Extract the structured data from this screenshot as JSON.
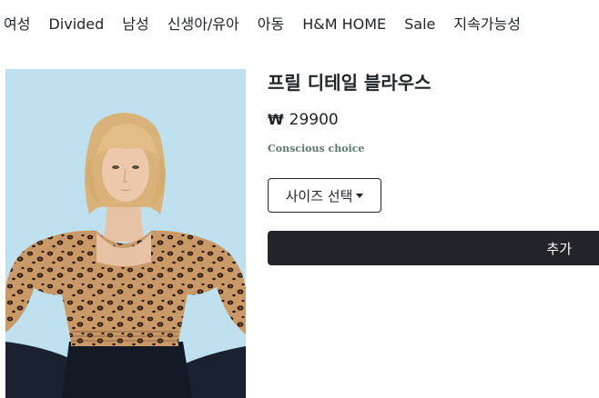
{
  "nav": {
    "items": [
      {
        "label": "여성"
      },
      {
        "label": "Divided"
      },
      {
        "label": "남성"
      },
      {
        "label": "신생아/유아"
      },
      {
        "label": "아동"
      },
      {
        "label": "H&M HOME"
      },
      {
        "label": "Sale"
      },
      {
        "label": "지속가능성"
      }
    ]
  },
  "product": {
    "title": "프릴 디테일 블라우스",
    "currency": "₩",
    "price": "29900",
    "badge": "Conscious choice",
    "size_select_label": "사이즈 선택",
    "add_button_label": "추가"
  },
  "colors": {
    "dark": "#212529",
    "badge_green": "#5b7a6a",
    "image_bg": "#bfe0ee"
  }
}
